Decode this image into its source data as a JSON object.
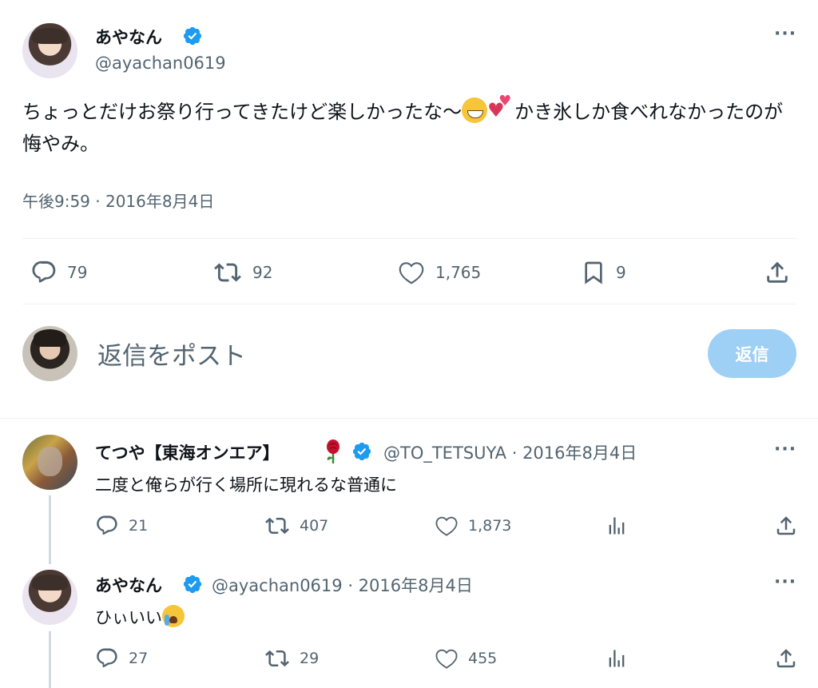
{
  "main_post": {
    "display_name": "あやなん",
    "handle": "@ayachan0619",
    "text_part1": "ちょっとだけお祭り行ってきたけど楽しかったな〜",
    "emoji1": "grinning-face-emoji",
    "emoji2": "two-hearts-emoji",
    "text_part2": "かき氷しか食べれなかったのが悔やみ。",
    "timestamp": "午後9:59 · 2016年8月4日",
    "stats": {
      "replies": "79",
      "reposts": "92",
      "likes": "1,765",
      "bookmarks": "9"
    }
  },
  "composer": {
    "placeholder": "返信をポスト",
    "button_label": "返信"
  },
  "replies": [
    {
      "display_name": "てつや【東海オンエア】",
      "badge_emoji": "rose-emoji",
      "handle_time": "@TO_TETSUYA · 2016年8月4日",
      "text": "二度と俺らが行く場所に現れるな普通に",
      "stats": {
        "replies": "21",
        "reposts": "407",
        "likes": "1,873"
      }
    },
    {
      "display_name": "あやなん",
      "handle_time": "@ayachan0619 · 2016年8月4日",
      "text": "ひぃいい",
      "emoji": "loudly-crying-face-emoji",
      "stats": {
        "replies": "27",
        "reposts": "29",
        "likes": "455"
      }
    }
  ],
  "colors": {
    "verified_blue": "#1d9bf0",
    "secondary_text": "#536471",
    "reply_button_disabled": "#9ecff5"
  }
}
